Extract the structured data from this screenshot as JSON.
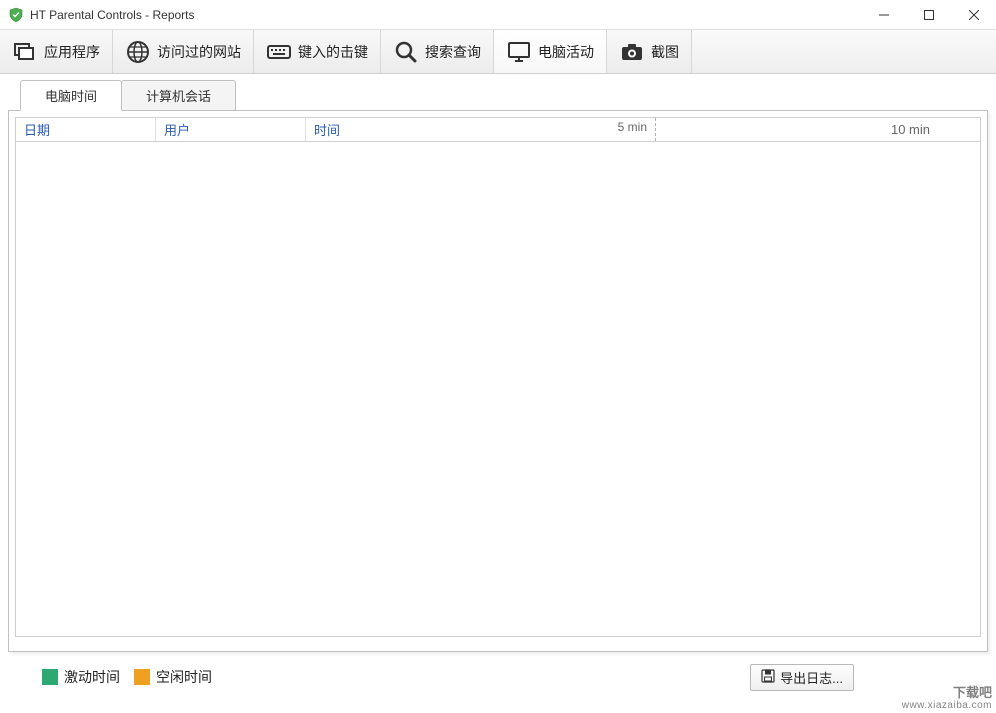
{
  "window": {
    "title": "HT Parental Controls - Reports"
  },
  "toolbar": {
    "apps": "应用程序",
    "websites": "访问过的网站",
    "keystrokes": "键入的击键",
    "search": "搜索查询",
    "activity": "电脑活动",
    "screenshots": "截图"
  },
  "subtabs": {
    "computer_time": "电脑时间",
    "computer_session": "计算机会话"
  },
  "table": {
    "headers": {
      "date": "日期",
      "user": "用户",
      "time": "时间",
      "mark5": "5 min",
      "mark10": "10 min"
    }
  },
  "legend": {
    "active": "激动时间",
    "idle": "空闲时间"
  },
  "actions": {
    "export": "导出日志..."
  },
  "watermark": {
    "main": "下载吧",
    "sub": "www.xiazaiba.com"
  }
}
